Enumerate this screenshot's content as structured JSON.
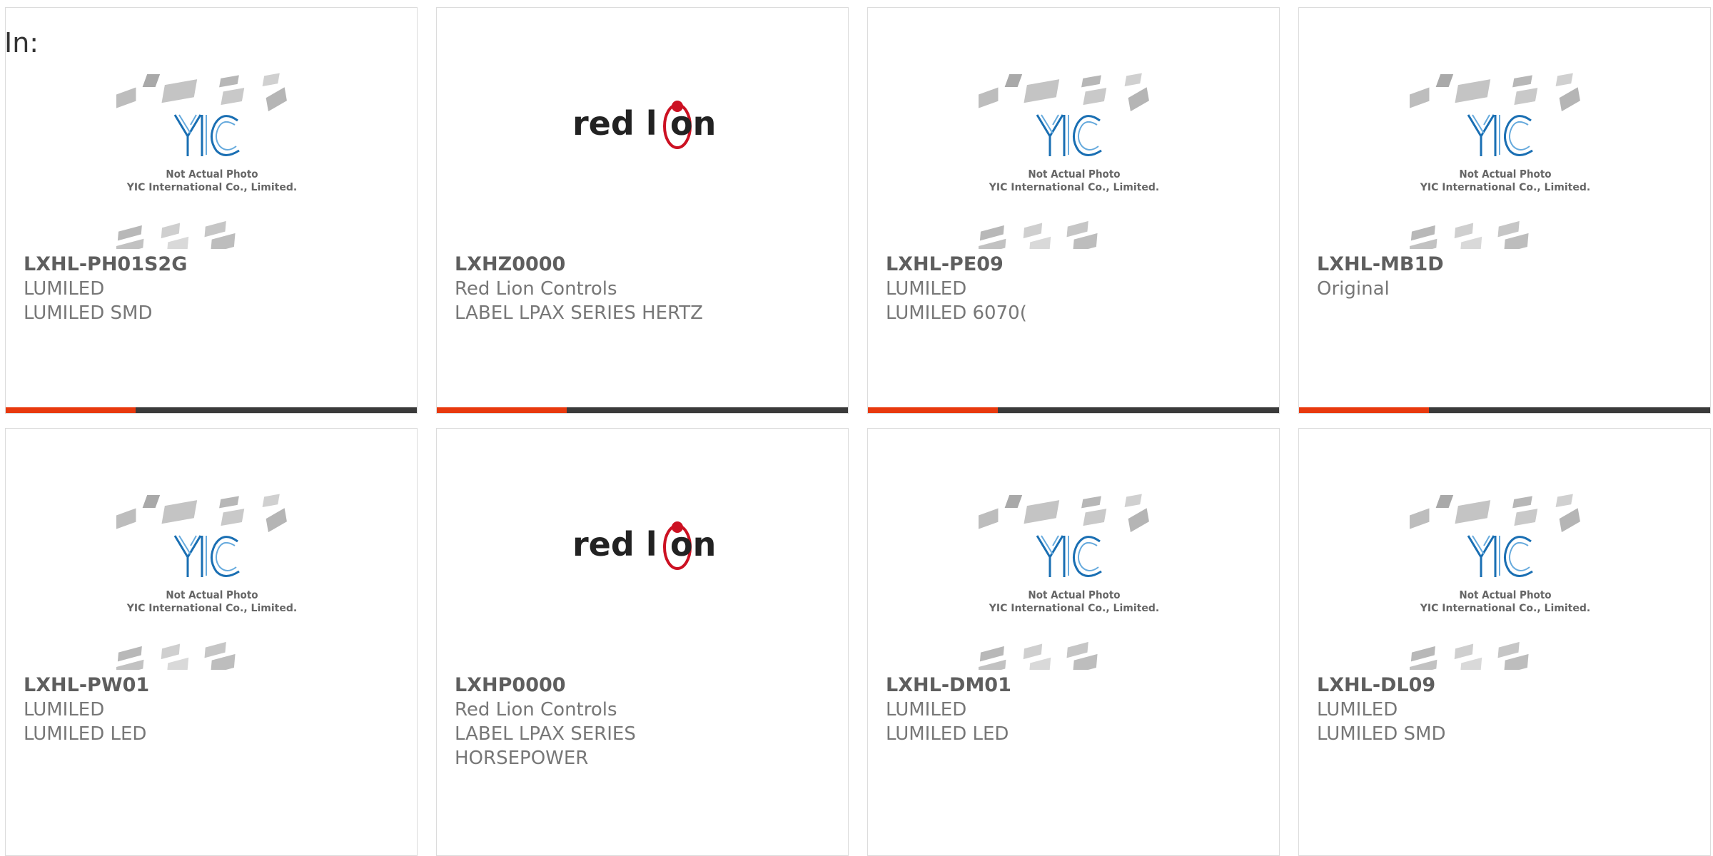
{
  "filter_label": "In:",
  "placeholder_watermark": {
    "line1": "Not Actual Photo",
    "line2": "YIC International Co., Limited.",
    "logo_text": "YIC"
  },
  "brand_logo": {
    "left_text": "red l",
    "right_text": "on",
    "accent_color": "#cc1122"
  },
  "colors": {
    "accent_bar": "#e8390e",
    "bar_dark": "#3a3a3a",
    "yic_blue": "#1a6fb3"
  },
  "products": [
    {
      "part": "LXHL-PH01S2G",
      "lines": [
        "LUMILED",
        "LUMILED SMD"
      ],
      "image": "yic-placeholder"
    },
    {
      "part": "LXHZ0000",
      "lines": [
        "Red Lion Controls",
        "LABEL LPAX SERIES HERTZ"
      ],
      "image": "red-lion-logo"
    },
    {
      "part": "LXHL-PE09",
      "lines": [
        "LUMILED",
        "LUMILED 6070("
      ],
      "image": "yic-placeholder"
    },
    {
      "part": "LXHL-MB1D",
      "lines": [
        "Original"
      ],
      "image": "yic-placeholder"
    },
    {
      "part": "LXHL-PW01",
      "lines": [
        "LUMILED",
        "LUMILED LED"
      ],
      "image": "yic-placeholder"
    },
    {
      "part": "LXHP0000",
      "lines": [
        "Red Lion Controls",
        "LABEL LPAX SERIES",
        "HORSEPOWER"
      ],
      "image": "red-lion-logo"
    },
    {
      "part": "LXHL-DM01",
      "lines": [
        "LUMILED",
        "LUMILED LED"
      ],
      "image": "yic-placeholder"
    },
    {
      "part": "LXHL-DL09",
      "lines": [
        "LUMILED",
        "LUMILED SMD"
      ],
      "image": "yic-placeholder"
    }
  ]
}
